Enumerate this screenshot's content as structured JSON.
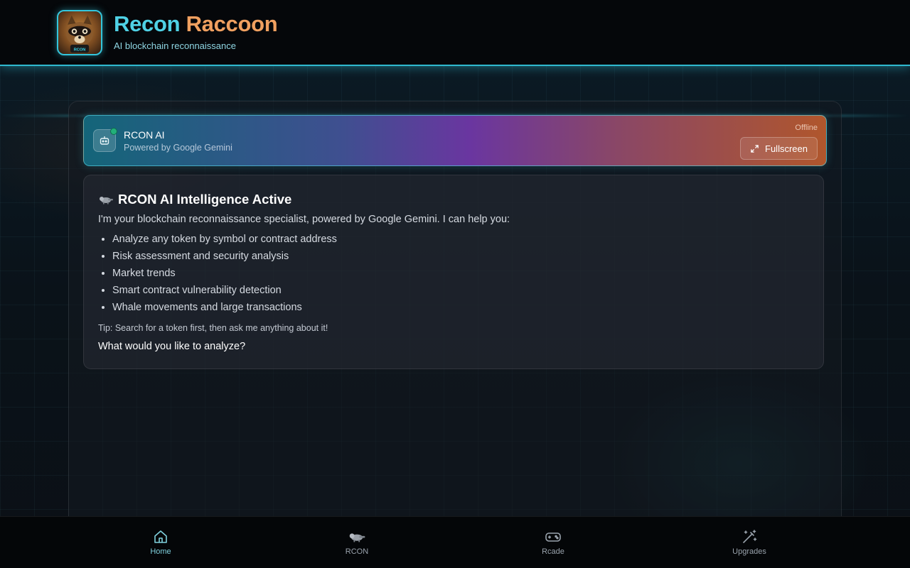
{
  "header": {
    "brand_word1": "Recon",
    "brand_word2": "Raccoon",
    "tagline": "AI blockchain reconnaissance",
    "logo_text": "RCON",
    "logo_icon": "raccoon-logo"
  },
  "chat": {
    "name": "RCON AI",
    "subtitle": "Powered by Google Gemini",
    "status": "Offline",
    "fullscreen_label": "Fullscreen",
    "bot_icon": "robot-icon"
  },
  "message": {
    "title": "RCON AI Intelligence Active",
    "intro": "I'm your blockchain reconnaissance specialist, powered by Google Gemini. I can help you:",
    "bullets": [
      "Analyze any token by symbol or contract address",
      "Risk assessment and security analysis",
      "Market trends",
      "Smart contract vulnerability detection",
      "Whale movements and large transactions"
    ],
    "tip": "Tip: Search for a token first, then ask me anything about it!",
    "question": "What would you like to analyze?"
  },
  "nav": [
    {
      "label": "Home",
      "icon": "home-icon",
      "active": true
    },
    {
      "label": "RCON",
      "icon": "raccoon-icon",
      "active": false
    },
    {
      "label": "Rcade",
      "icon": "gamepad-icon",
      "active": false
    },
    {
      "label": "Upgrades",
      "icon": "magic-wand-icon",
      "active": false
    }
  ],
  "colors": {
    "accent_cyan": "#2fb9cf",
    "brand_orange": "#f0a060",
    "online_dot": "#22b07a"
  }
}
